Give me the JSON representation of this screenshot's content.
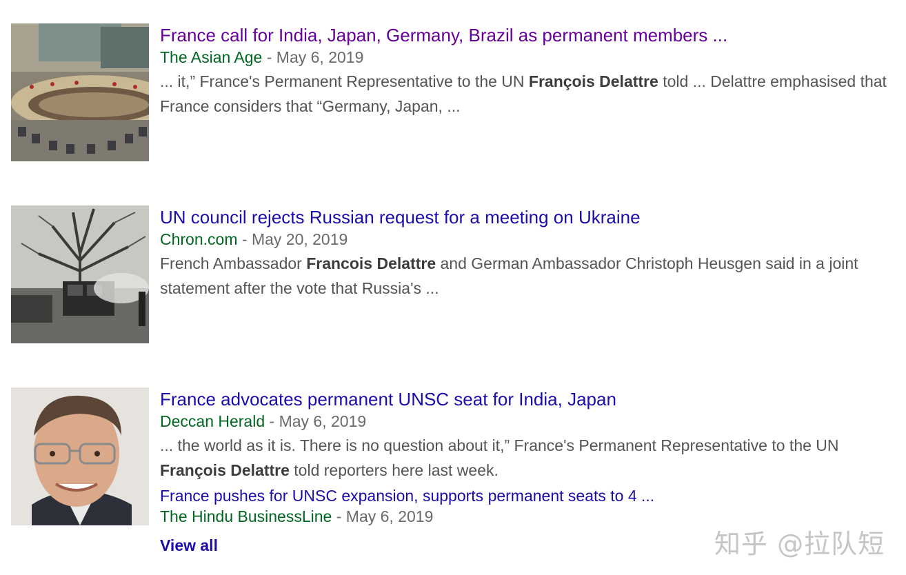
{
  "results": [
    {
      "thumbnail_icon": "un-security-council-chamber-photo",
      "title": "France call for India, Japan, Germany, Brazil as permanent members ...",
      "source": "The Asian Age",
      "date_sep": " - ",
      "date": "May 6, 2019",
      "snippet": [
        {
          "text": "... it,” France's Permanent Representative to the UN ",
          "bold": false
        },
        {
          "text": "François Delattre",
          "bold": true
        },
        {
          "text": " told ... Delattre emphasised that France considers that “Germany, Japan, ...",
          "bold": false
        }
      ]
    },
    {
      "thumbnail_icon": "ukraine-tree-vehicle-photo",
      "title": "UN council rejects Russian request for a meeting on Ukraine",
      "source": "Chron.com",
      "date_sep": " - ",
      "date": "May 20, 2019",
      "snippet": [
        {
          "text": "French Ambassador ",
          "bold": false
        },
        {
          "text": "Francois Delattre",
          "bold": true
        },
        {
          "text": " and German Ambassador Christoph Heusgen said in a joint statement after the vote that Russia's ...",
          "bold": false
        }
      ]
    },
    {
      "thumbnail_icon": "man-portrait-photo",
      "title": "France advocates permanent UNSC seat for India, Japan",
      "source": "Deccan Herald",
      "date_sep": " - ",
      "date": "May 6, 2019",
      "snippet": [
        {
          "text": "... the world as it is. There is no question about it,” France's Permanent Representative to the UN ",
          "bold": false
        },
        {
          "text": "François Delattre",
          "bold": true
        },
        {
          "text": " told reporters here last week.",
          "bold": false
        }
      ],
      "sub": {
        "title": "France pushes for UNSC expansion, supports permanent seats to 4 ...",
        "source": "The Hindu BusinessLine",
        "date_sep": " - ",
        "date": "May 6, 2019"
      }
    }
  ],
  "view_all": "View all",
  "watermark": "知乎 @拉队短",
  "colors": {
    "link": "#1a0dab",
    "visited": "#660099",
    "source": "#006621",
    "snippet": "#545454"
  }
}
